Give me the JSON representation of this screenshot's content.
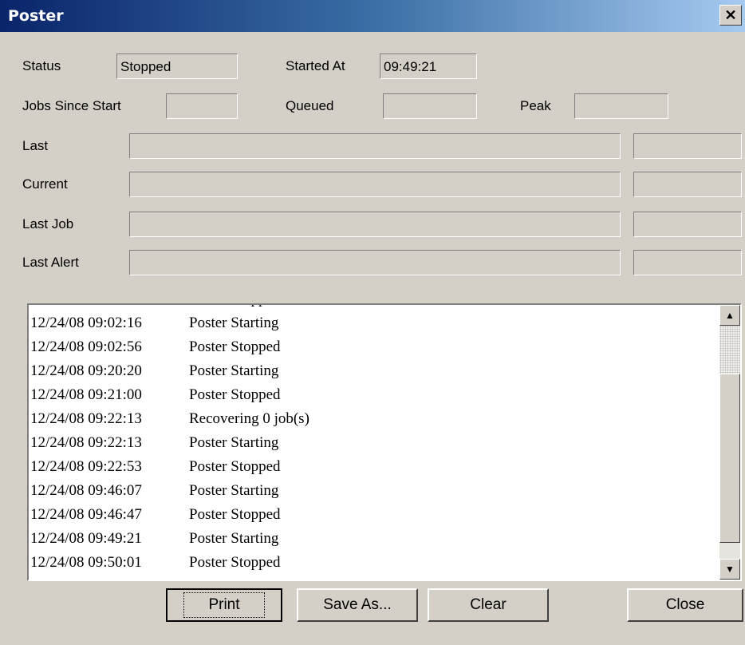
{
  "window": {
    "title": "Poster",
    "close_glyph": "✕"
  },
  "fields": {
    "status_label": "Status",
    "status_value": "Stopped",
    "started_at_label": "Started At",
    "started_at_value": "09:49:21",
    "jobs_since_start_label": "Jobs Since Start",
    "jobs_since_start_value": "",
    "queued_label": "Queued",
    "queued_value": "",
    "peak_label": "Peak",
    "peak_value": "",
    "last_label": "Last",
    "last_value": "",
    "last_extra": "",
    "current_label": "Current",
    "current_value": "",
    "current_extra": "",
    "last_job_label": "Last Job",
    "last_job_value": "",
    "last_job_extra": "",
    "last_alert_label": "Last Alert",
    "last_alert_value": "",
    "last_alert_extra": ""
  },
  "log": [
    {
      "time": "",
      "message": "Poster Stopped"
    },
    {
      "time": "12/24/08 09:02:16",
      "message": "Poster Starting"
    },
    {
      "time": "12/24/08 09:02:56",
      "message": "Poster Stopped"
    },
    {
      "time": "12/24/08 09:20:20",
      "message": "Poster Starting"
    },
    {
      "time": "12/24/08 09:21:00",
      "message": "Poster Stopped"
    },
    {
      "time": "12/24/08 09:22:13",
      "message": "Recovering 0 job(s)"
    },
    {
      "time": "12/24/08 09:22:13",
      "message": "Poster Starting"
    },
    {
      "time": "12/24/08 09:22:53",
      "message": "Poster Stopped"
    },
    {
      "time": "12/24/08 09:46:07",
      "message": "Poster Starting"
    },
    {
      "time": "12/24/08 09:46:47",
      "message": "Poster Stopped"
    },
    {
      "time": "12/24/08 09:49:21",
      "message": "Poster Starting"
    },
    {
      "time": "12/24/08 09:50:01",
      "message": "Poster Stopped"
    }
  ],
  "scrollbar": {
    "up_glyph": "▲",
    "down_glyph": "▼"
  },
  "buttons": {
    "print": "Print",
    "save_as": "Save As...",
    "clear": "Clear",
    "close": "Close"
  },
  "colors": {
    "titlebar_start": "#0a246a",
    "titlebar_end": "#a6caf0",
    "face": "#d4d0c8"
  }
}
